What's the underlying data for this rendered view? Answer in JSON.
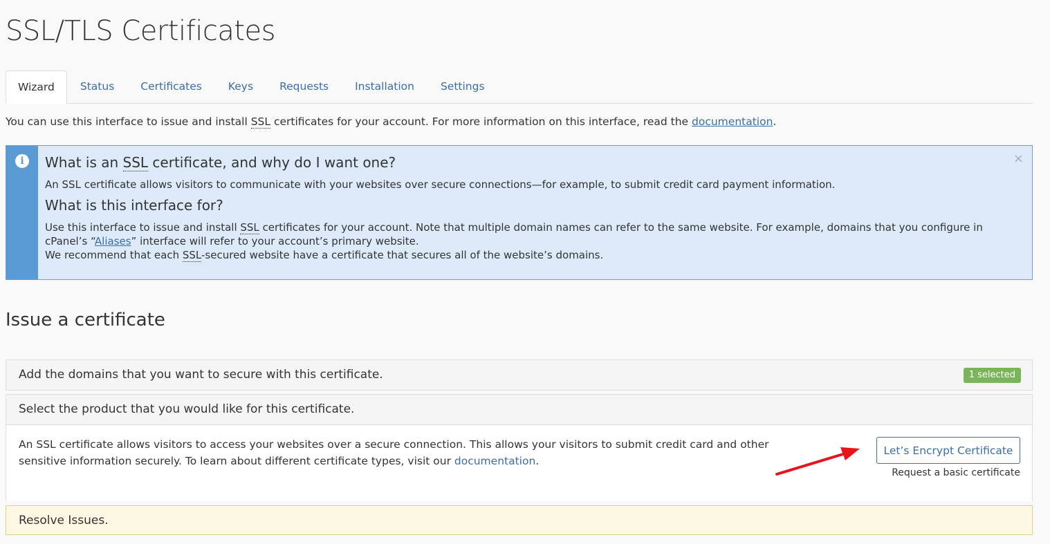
{
  "page": {
    "title": "SSL/TLS Certificates"
  },
  "tabs": [
    {
      "label": "Wizard"
    },
    {
      "label": "Status"
    },
    {
      "label": "Certificates"
    },
    {
      "label": "Keys"
    },
    {
      "label": "Requests"
    },
    {
      "label": "Installation"
    },
    {
      "label": "Settings"
    }
  ],
  "intro": {
    "text_before": "You can use this interface to issue and install ",
    "ssl": "SSL",
    "text_after": " certificates for your account. For more information on this interface, read the ",
    "link": "documentation",
    "end": "."
  },
  "alert": {
    "icon": "info-icon",
    "close": "×",
    "heading1_before": "What is an ",
    "heading1_ssl": "SSL",
    "heading1_after": " certificate, and why do I want one?",
    "para1": "An SSL certificate allows visitors to communicate with your websites over secure connections—for example, to submit credit card payment information.",
    "heading2": "What is this interface for?",
    "para2_a": "Use this interface to issue and install ",
    "para2_ssl": "SSL",
    "para2_b": " certificates for your account. Note that multiple domain names can refer to the same website. For example, domains that you configure in cPanel’s “",
    "para2_link": "Aliases",
    "para2_c": "” interface will refer to your account’s primary website.",
    "para3_a": "We recommend that each ",
    "para3_ssl": "SSL",
    "para3_b": "-secured website have a certificate that secures all of the website’s domains."
  },
  "issue": {
    "title": "Issue a certificate",
    "domains_header": "Add the domains that you want to secure with this certificate.",
    "domains_badge": "1 selected",
    "product_header": "Select the product that you would like for this certificate.",
    "product_text": "An SSL certificate allows visitors to access your websites over a secure connection. This allows your visitors to submit credit card and other sensitive information securely. To learn about different certificate types, visit our ",
    "product_link": "documentation",
    "product_end": ".",
    "le_button": "Let’s Encrypt Certificate",
    "le_sub": "Request a basic certificate",
    "resolve_header": "Resolve Issues."
  },
  "colors": {
    "link": "#3a6ea5",
    "info_bg": "#dceafa",
    "info_side": "#5b9bd5",
    "badge": "#7ab55c",
    "warning_bg": "#fcf8e3",
    "arrow": "#e8141b"
  }
}
